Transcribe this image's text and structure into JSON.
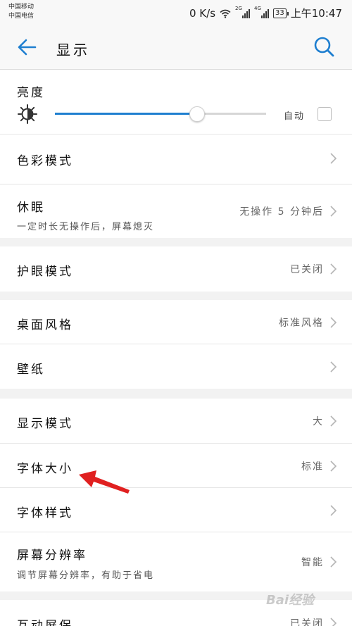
{
  "status_bar": {
    "carrier_1": "中国移动",
    "carrier_2": "中国电信",
    "speed": "0 K/s",
    "net_1": "2G",
    "net_2": "4G",
    "battery": "33",
    "time": "上午10:47"
  },
  "app_bar": {
    "title": "显示"
  },
  "brightness": {
    "label": "亮度",
    "level_percent": 67,
    "auto_label": "自动",
    "auto_checked": false
  },
  "rows": {
    "color_mode": {
      "label": "色彩模式"
    },
    "sleep": {
      "label": "休眠",
      "subtitle": "一定时长无操作后，屏幕熄灭",
      "value": "无操作 5 分钟后"
    },
    "eye_comfort": {
      "label": "护眼模式",
      "value": "已关闭"
    },
    "home_style": {
      "label": "桌面风格",
      "value": "标准风格"
    },
    "wallpaper": {
      "label": "壁纸"
    },
    "display_mode": {
      "label": "显示模式",
      "value": "大"
    },
    "font_size": {
      "label": "字体大小",
      "value": "标准"
    },
    "font_style": {
      "label": "字体样式"
    },
    "resolution": {
      "label": "屏幕分辨率",
      "subtitle": "调节屏幕分辨率，有助于省电",
      "value": "智能"
    },
    "screensaver": {
      "label": "互动屏保",
      "value": "已关闭"
    }
  },
  "annotation": {
    "color": "#e02020"
  },
  "watermark": {
    "text": "Bai经验"
  },
  "colors": {
    "accent": "#1f7fd0",
    "arrow": "#e02020"
  }
}
